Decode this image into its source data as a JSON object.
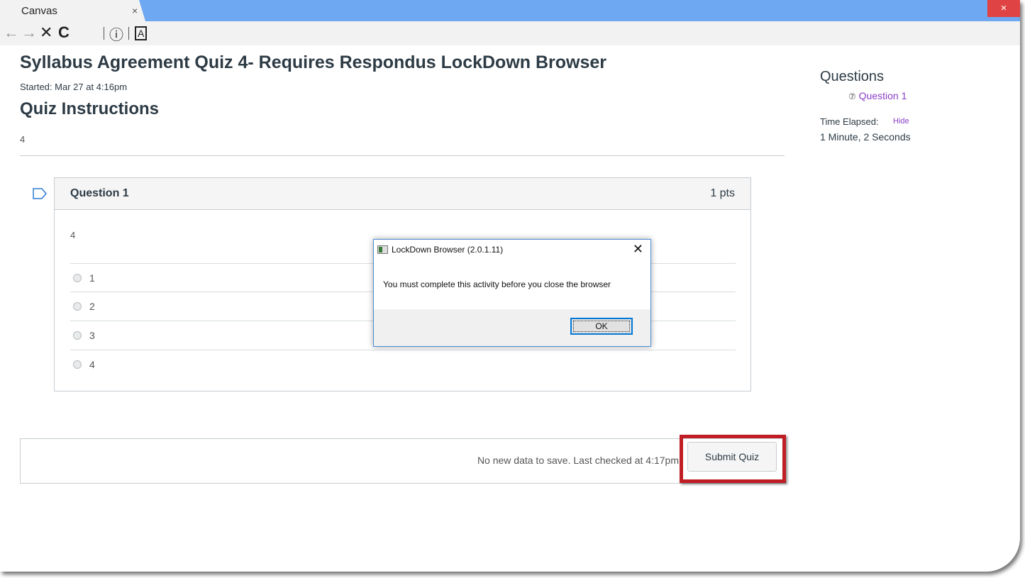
{
  "browser": {
    "tab_title": "Canvas",
    "tab_close": "×",
    "window_close": "×",
    "toolbar": {
      "back_icon": "←",
      "forward_icon": "→",
      "stop_icon": "✕",
      "reload_icon": "C",
      "info_icon": "ⓘ",
      "reader_icon": "A"
    }
  },
  "quiz": {
    "title": "Syllabus Agreement Quiz 4- Requires Respondus LockDown Browser",
    "started": "Started: Mar 27 at 4:16pm",
    "instructions_heading": "Quiz Instructions",
    "instructions_body": "4"
  },
  "question": {
    "name": "Question 1",
    "points": "1 pts",
    "text": "4",
    "answers": [
      "1",
      "2",
      "3",
      "4"
    ]
  },
  "footer": {
    "save_status": "No new data to save. Last checked at 4:17pm",
    "submit_label": "Submit Quiz"
  },
  "sidebar": {
    "title": "Questions",
    "question_link": "Question 1",
    "question_icon": "⑦",
    "time_label": "Time Elapsed:",
    "hide_label": "Hide",
    "time_value": "1 Minute, 2 Seconds"
  },
  "dialog": {
    "title": "LockDown Browser (2.0.1.11)",
    "close": "✕",
    "message": "You must complete this activity before you close the browser",
    "ok_label": "OK"
  },
  "colors": {
    "accent_link": "#8a3fc4",
    "highlight_border": "#c01e24",
    "tabbar": "#6fa8f2",
    "window_close": "#e04343"
  }
}
